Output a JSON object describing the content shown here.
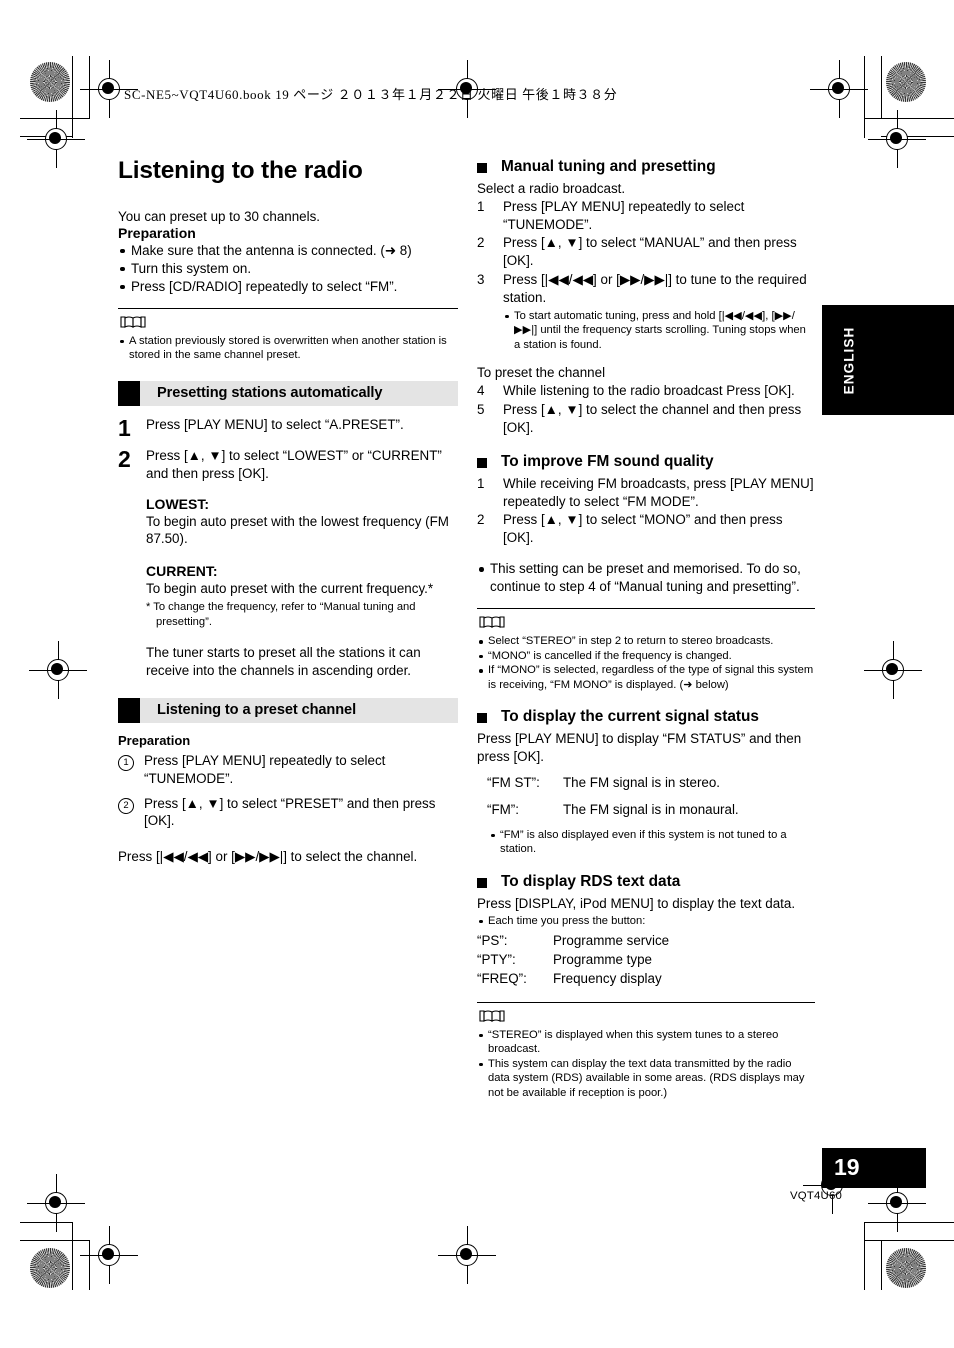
{
  "meta": {
    "file_header": "SC-NE5~VQT4U60.book   19 ページ   ２０１３年１月２２日   火曜日   午後１時３８分",
    "language_tab": "ENGLISH",
    "page_number": "19",
    "model_code": "VQT4U60"
  },
  "left": {
    "title": "Listening to the radio",
    "intro": "You can preset up to 30 channels.",
    "preparation_heading": "Preparation",
    "preparation_items": [
      "Make sure that the antenna is connected. (➜ 8)",
      "Turn this system on.",
      "Press [CD/RADIO] repeatedly to select “FM”."
    ],
    "note1": [
      "A station previously stored is overwritten when another station is stored in the same channel preset."
    ],
    "section1": {
      "heading": "Presetting stations automatically",
      "step1_num": "1",
      "step1_text": "Press [PLAY MENU] to select “A.PRESET”.",
      "step2_num": "2",
      "step2_text": "Press [▲, ▼] to select “LOWEST” or “CURRENT” and then press [OK].",
      "lowest_label": "LOWEST:",
      "lowest_text": "To begin auto preset with the lowest frequency (FM 87.50).",
      "current_label": "CURRENT:",
      "current_text": "To begin auto preset with the current frequency.*",
      "footnote": "*  To change the frequency, refer to “Manual tuning and presetting”.",
      "closing": "The tuner starts to preset all the stations it can receive into the channels in ascending order."
    },
    "section2": {
      "heading": "Listening to a preset channel",
      "preparation_heading": "Preparation",
      "step1_num": "1",
      "step1_text": "Press [PLAY MENU] repeatedly to select “TUNEMODE”.",
      "step2_num": "2",
      "step2_text": "Press [▲, ▼] to select “PRESET” and then press [OK].",
      "closing": "Press [|◀◀/◀◀] or [▶▶/▶▶|] to select the channel."
    }
  },
  "right": {
    "section_manual": {
      "heading": "Manual tuning and presetting",
      "lead": "Select a radio broadcast.",
      "steps": [
        {
          "n": "1",
          "text": "Press [PLAY MENU] repeatedly to select “TUNEMODE”."
        },
        {
          "n": "2",
          "text": "Press [▲, ▼] to select “MANUAL” and then press [OK]."
        },
        {
          "n": "3",
          "text": "Press [|◀◀/◀◀] or [▶▶/▶▶|] to tune to the required station."
        }
      ],
      "step3_bullets": [
        "To start automatic tuning, press and hold [|◀◀/◀◀], [▶▶/▶▶|] until the frequency starts scrolling. Tuning stops when a station is found."
      ],
      "preset_lead": "To preset the channel",
      "steps2": [
        {
          "n": "4",
          "text": "While listening to the radio broadcast Press [OK]."
        },
        {
          "n": "5",
          "text": "Press [▲, ▼] to select the channel and then press [OK]."
        }
      ]
    },
    "section_fm_quality": {
      "heading": "To improve FM sound quality",
      "steps": [
        {
          "n": "1",
          "text": "While receiving FM broadcasts, press [PLAY MENU] repeatedly to select “FM MODE”."
        },
        {
          "n": "2",
          "text": "Press [▲, ▼] to select “MONO” and then press [OK]."
        }
      ],
      "bullets": [
        "This setting can be preset and memorised. To do so, continue to step 4 of “Manual tuning and presetting”."
      ],
      "note_bullets": [
        "Select “STEREO” in step 2 to return to stereo broadcasts.",
        "“MONO” is cancelled if the frequency is changed.",
        "If “MONO” is selected, regardless of the type of signal this system is receiving, “FM MONO” is displayed. (➜ below)"
      ]
    },
    "section_signal_status": {
      "heading": "To display the current signal status",
      "lead": "Press [PLAY MENU] to display “FM STATUS” and then press [OK].",
      "definitions": [
        {
          "key": "“FM ST”:",
          "value": "The FM signal is in stereo."
        },
        {
          "key": "“FM”:",
          "value": "The FM signal is in monaural."
        }
      ],
      "bullets": [
        "“FM” is also displayed even if this system is not tuned to a station."
      ]
    },
    "section_rds": {
      "heading": "To display RDS text data",
      "lead": "Press [DISPLAY, iPod MENU] to display the text data.",
      "bullets": [
        "Each time you press the button:"
      ],
      "definitions": [
        {
          "key": "“PS”:",
          "value": "Programme service"
        },
        {
          "key": "“PTY”:",
          "value": "Programme type"
        },
        {
          "key": "“FREQ”:",
          "value": "Frequency display"
        }
      ],
      "note_bullets": [
        "“STEREO” is displayed when this system tunes to a stereo broadcast.",
        "This system can display the text data transmitted by the radio data system (RDS) available in some areas. (RDS displays may not be available if reception is poor.)"
      ]
    }
  }
}
